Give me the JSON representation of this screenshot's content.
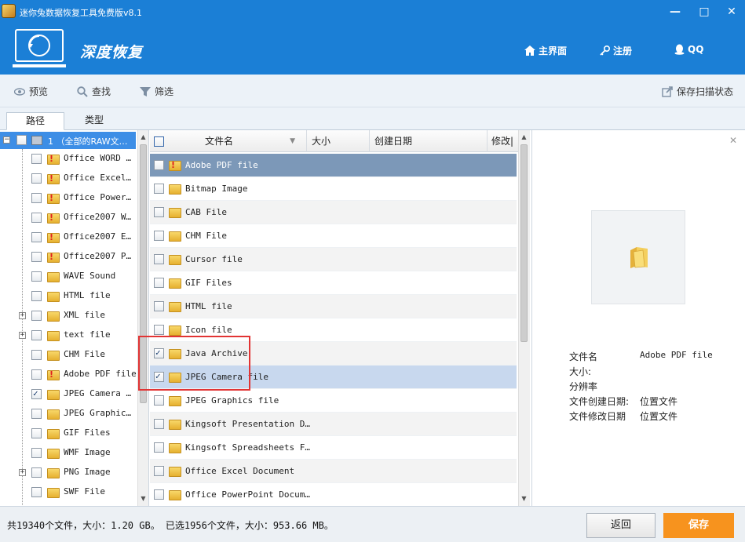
{
  "window": {
    "title": "迷你兔数据恢复工具免费版v8.1",
    "minimize": "—",
    "maximize": "□",
    "close": "✕"
  },
  "header": {
    "title": "深度恢复",
    "nav": [
      {
        "icon": "home-icon",
        "label": "主界面"
      },
      {
        "icon": "key-icon",
        "label": "注册"
      },
      {
        "icon": "qq-icon",
        "label": "QQ"
      }
    ]
  },
  "toolbar": {
    "preview": "预览",
    "search": "查找",
    "filter": "筛选",
    "save_scan": "保存扫描状态"
  },
  "tabs": [
    {
      "label": "路径",
      "active": true
    },
    {
      "label": "类型",
      "active": false
    }
  ],
  "tree": {
    "root": {
      "expander": "−",
      "label": "1 （全部的RAW文…"
    },
    "items": [
      {
        "label": "Office WORD …",
        "checked": false,
        "err": true,
        "expand": false
      },
      {
        "label": "Office Excel…",
        "checked": false,
        "err": true,
        "expand": false
      },
      {
        "label": "Office Power…",
        "checked": false,
        "err": true,
        "expand": false
      },
      {
        "label": "Office2007 W…",
        "checked": false,
        "err": true,
        "expand": false
      },
      {
        "label": "Office2007 E…",
        "checked": false,
        "err": true,
        "expand": false
      },
      {
        "label": "Office2007 P…",
        "checked": false,
        "err": true,
        "expand": false
      },
      {
        "label": "WAVE Sound",
        "checked": false,
        "err": false,
        "expand": false
      },
      {
        "label": "HTML file",
        "checked": false,
        "err": false,
        "expand": false
      },
      {
        "label": "XML file",
        "checked": false,
        "err": false,
        "expand": true
      },
      {
        "label": "text file",
        "checked": false,
        "err": false,
        "expand": true
      },
      {
        "label": "CHM File",
        "checked": false,
        "err": false,
        "expand": false
      },
      {
        "label": "Adobe PDF file",
        "checked": false,
        "err": true,
        "expand": false
      },
      {
        "label": "JPEG Camera …",
        "checked": true,
        "err": false,
        "expand": false
      },
      {
        "label": "JPEG Graphic…",
        "checked": false,
        "err": false,
        "expand": false
      },
      {
        "label": "GIF Files",
        "checked": false,
        "err": false,
        "expand": false
      },
      {
        "label": "WMF Image",
        "checked": false,
        "err": false,
        "expand": false
      },
      {
        "label": "PNG Image",
        "checked": false,
        "err": false,
        "expand": true
      },
      {
        "label": "SWF File",
        "checked": false,
        "err": false,
        "expand": false
      }
    ]
  },
  "list": {
    "columns": [
      "文件名",
      "大小",
      "创建日期",
      "修改|"
    ],
    "rows": [
      {
        "name": "Adobe PDF file",
        "checked": false,
        "style": "sel-dark"
      },
      {
        "name": "Bitmap Image",
        "checked": false,
        "style": ""
      },
      {
        "name": "CAB File",
        "checked": false,
        "style": "alt"
      },
      {
        "name": "CHM File",
        "checked": false,
        "style": ""
      },
      {
        "name": "Cursor file",
        "checked": false,
        "style": "alt"
      },
      {
        "name": "GIF Files",
        "checked": false,
        "style": ""
      },
      {
        "name": "HTML file",
        "checked": false,
        "style": "alt"
      },
      {
        "name": "Icon file",
        "checked": false,
        "style": ""
      },
      {
        "name": "Java Archive",
        "checked": true,
        "style": "alt"
      },
      {
        "name": "JPEG Camera file",
        "checked": true,
        "style": "sel-light"
      },
      {
        "name": "JPEG Graphics file",
        "checked": false,
        "style": ""
      },
      {
        "name": "Kingsoft Presentation D…",
        "checked": false,
        "style": "alt"
      },
      {
        "name": "Kingsoft Spreadsheets F…",
        "checked": false,
        "style": ""
      },
      {
        "name": "Office Excel Document",
        "checked": false,
        "style": "alt"
      },
      {
        "name": "Office PowerPoint Docum…",
        "checked": false,
        "style": ""
      }
    ]
  },
  "preview": {
    "close": "✕",
    "fields": [
      {
        "label": "文件名",
        "value": "Adobe PDF file"
      },
      {
        "label": "大小:",
        "value": ""
      },
      {
        "label": "分辨率",
        "value": ""
      },
      {
        "label": "文件创建日期:",
        "value": "位置文件"
      },
      {
        "label": "文件修改日期",
        "value": "位置文件"
      }
    ]
  },
  "status": {
    "text": "共19340个文件，大小：1.20 GB。 已选1956个文件，大小：953.66 MB。"
  },
  "buttons": {
    "back": "返回",
    "save": "保存"
  },
  "colors": {
    "brand": "#1b7fd6",
    "save": "#f7931e",
    "highlight": "#e23434"
  }
}
